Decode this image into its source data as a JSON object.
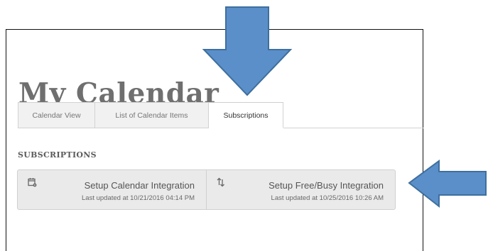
{
  "page": {
    "title": "My Calendar"
  },
  "tabs": [
    {
      "label": "Calendar View",
      "active": false
    },
    {
      "label": "List of Calendar Items",
      "active": false
    },
    {
      "label": "Subscriptions",
      "active": true
    }
  ],
  "subscriptions": {
    "heading": "SUBSCRIPTIONS",
    "items": [
      {
        "icon": "calendar-settings-icon",
        "title": "Setup Calendar Integration",
        "updated": "Last updated at 10/21/2016 04:14 PM"
      },
      {
        "icon": "sync-arrows-icon",
        "title": "Setup Free/Busy Integration",
        "updated": "Last updated at 10/25/2016 10:26 AM"
      }
    ]
  },
  "annotations": {
    "arrow_color": "#5b8fc9",
    "arrow_outline": "#3e6f9e",
    "arrows": [
      "down-arrow",
      "left-arrow"
    ]
  }
}
